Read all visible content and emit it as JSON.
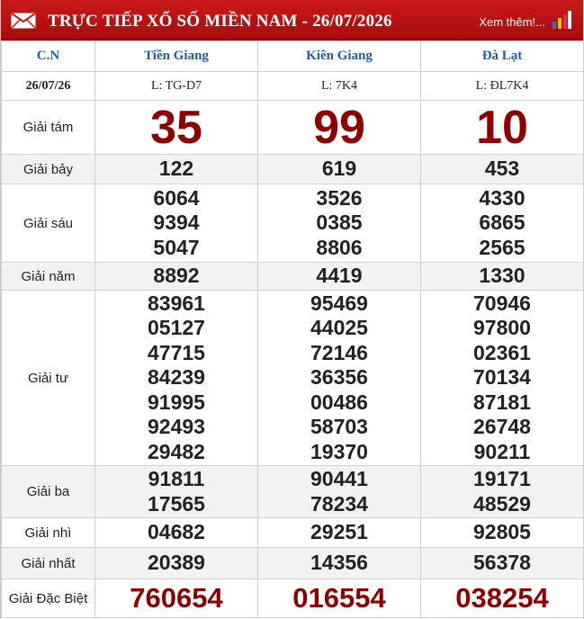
{
  "header": {
    "title": "TRỰC TIẾP XỔ SỐ MIỀN NAM - 26/07/2026",
    "more_link": "Xem thêm!..."
  },
  "table": {
    "corner_label": "C.N",
    "date": "26/07/26",
    "provinces": [
      {
        "name": "Tiền Giang",
        "ticket": "L: TG-D7"
      },
      {
        "name": "Kiên Giang",
        "ticket": "L: 7K4"
      },
      {
        "name": "Đà Lạt",
        "ticket": "L: ĐL7K4"
      }
    ],
    "prizes": {
      "g8": {
        "label": "Giải tám",
        "values": [
          "35",
          "99",
          "10"
        ]
      },
      "g7": {
        "label": "Giải bảy",
        "values": [
          "122",
          "619",
          "453"
        ]
      },
      "g6": {
        "label": "Giải sáu",
        "values": [
          [
            "6064",
            "9394",
            "5047"
          ],
          [
            "3526",
            "0385",
            "8806"
          ],
          [
            "4330",
            "6865",
            "2565"
          ]
        ]
      },
      "g5": {
        "label": "Giải năm",
        "values": [
          "8892",
          "4419",
          "1330"
        ]
      },
      "g4": {
        "label": "Giải tư",
        "values": [
          [
            "83961",
            "05127",
            "47715",
            "84239",
            "91995",
            "92493",
            "29482"
          ],
          [
            "95469",
            "44025",
            "72146",
            "36356",
            "00486",
            "58703",
            "19370"
          ],
          [
            "70946",
            "97800",
            "02361",
            "70134",
            "87181",
            "26748",
            "90211"
          ]
        ]
      },
      "g3": {
        "label": "Giải ba",
        "values": [
          [
            "91811",
            "17565"
          ],
          [
            "90441",
            "78234"
          ],
          [
            "19171",
            "48529"
          ]
        ]
      },
      "g2": {
        "label": "Giải nhì",
        "values": [
          "04682",
          "29251",
          "92805"
        ]
      },
      "g1": {
        "label": "Giải nhất",
        "values": [
          "20389",
          "14356",
          "56378"
        ]
      },
      "db": {
        "label": "Giải Đặc Biệt",
        "values": [
          "760654",
          "016554",
          "038254"
        ]
      }
    }
  }
}
